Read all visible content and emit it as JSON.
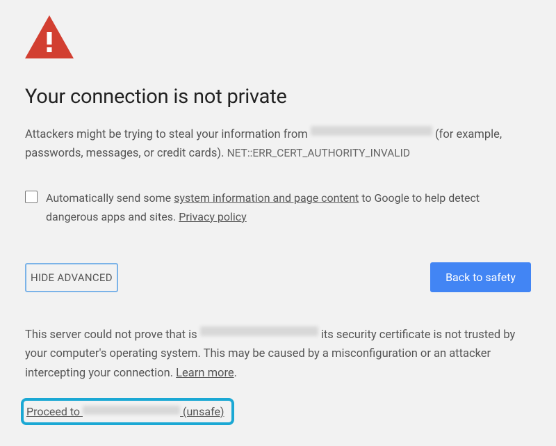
{
  "title": "Your connection is not private",
  "description": {
    "prefix": "Attackers might be trying to steal your information from ",
    "suffix": " (for example, passwords, messages, or credit cards). ",
    "error_code": "NET::ERR_CERT_AUTHORITY_INVALID"
  },
  "checkbox": {
    "text_before": "Automatically send some ",
    "link1": "system information and page content",
    "text_mid": " to Google to help detect dangerous apps and sites. ",
    "link2": "Privacy policy"
  },
  "buttons": {
    "hide_advanced": "HIDE ADVANCED",
    "back_to_safety": "Back to safety"
  },
  "advanced": {
    "text_before": "This server could not prove that is ",
    "text_after": " its security certificate is not trusted by your computer's operating system. This may be caused by a misconfiguration or an attacker intercepting your connection. ",
    "learn_more": "Learn more",
    "period": "."
  },
  "proceed": {
    "prefix": "Proceed to ",
    "suffix": " (unsafe)"
  }
}
